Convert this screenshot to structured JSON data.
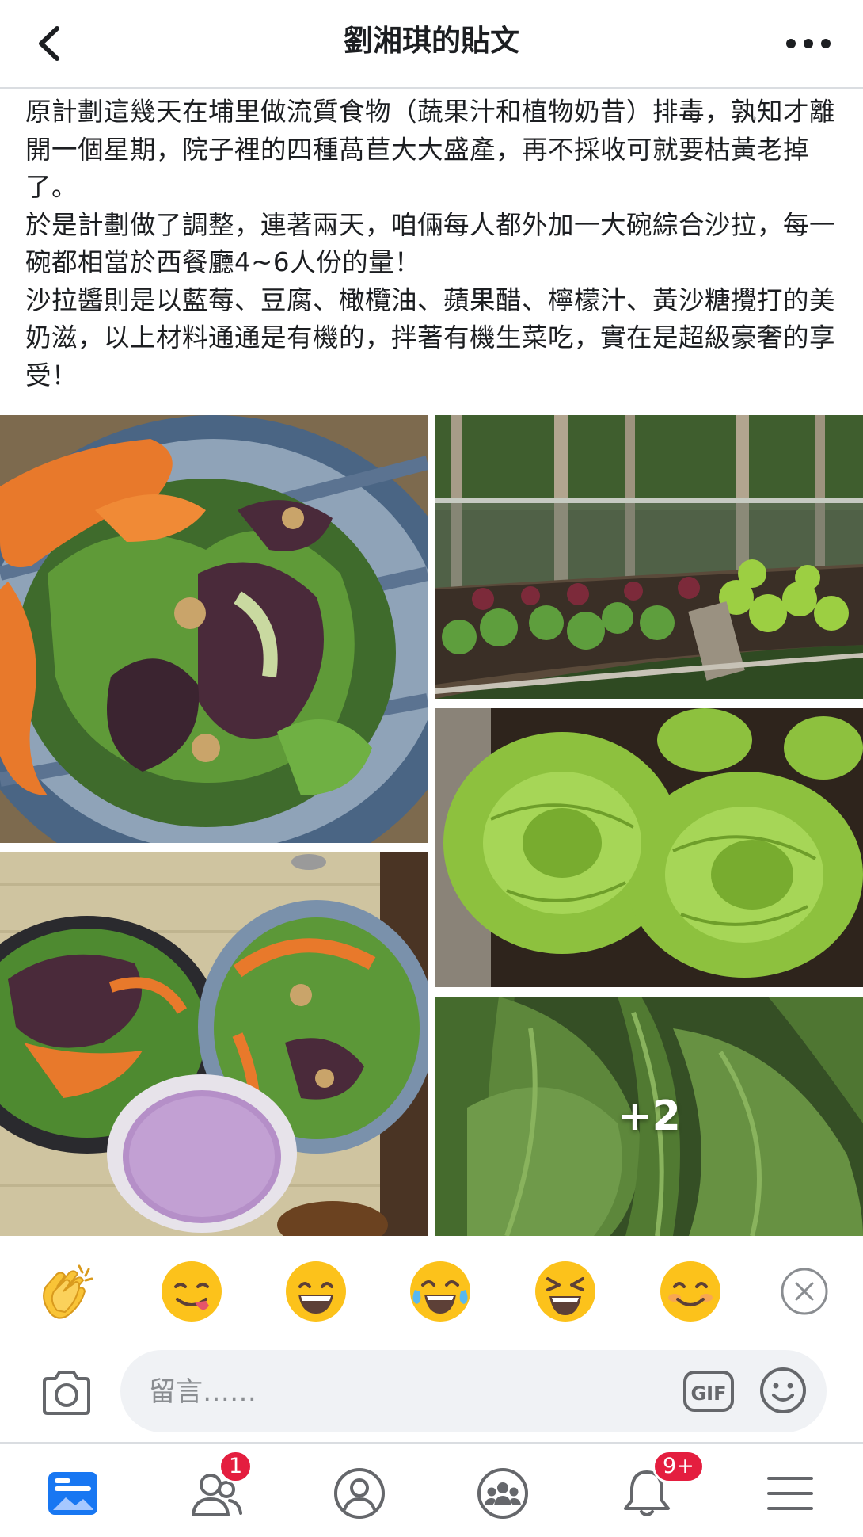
{
  "header": {
    "title": "劉湘琪的貼文"
  },
  "post": {
    "paragraphs": [
      "原計劃這幾天在埔里做流質食物（蔬果汁和植物奶昔）排毒，孰知才離開一個星期，院子裡的四種萵苣大大盛產，再不採收可就要枯黃老掉了。",
      "於是計劃做了調整，連著兩天，咱倆每人都外加一大碗綜合沙拉，每一碗都相當於西餐廳4~6人份的量！",
      "沙拉醬則是以藍莓、豆腐、橄欖油、蘋果醋、檸檬汁、黃沙糖攪打的美奶滋，以上材料通通是有機的，拌著有機生菜吃，實在是超級豪奢的享受！"
    ],
    "more_photos_label": "+2"
  },
  "reactions": [
    {
      "name": "clapping-hands-icon",
      "glyph": "👏"
    },
    {
      "name": "yum-face-icon",
      "glyph": "😋"
    },
    {
      "name": "grinning-face-icon",
      "glyph": "😄"
    },
    {
      "name": "tears-of-joy-icon",
      "glyph": "😂"
    },
    {
      "name": "squinting-laugh-icon",
      "glyph": "😆"
    },
    {
      "name": "smiling-face-icon",
      "glyph": "😊"
    }
  ],
  "comment": {
    "placeholder": "留言……",
    "gif_label": "GIF"
  },
  "nav": {
    "friends_badge": "1",
    "notifications_badge": "9+"
  },
  "colors": {
    "accent": "#1877f2",
    "badge": "#e41e3f",
    "icon_gray": "#65676b"
  }
}
